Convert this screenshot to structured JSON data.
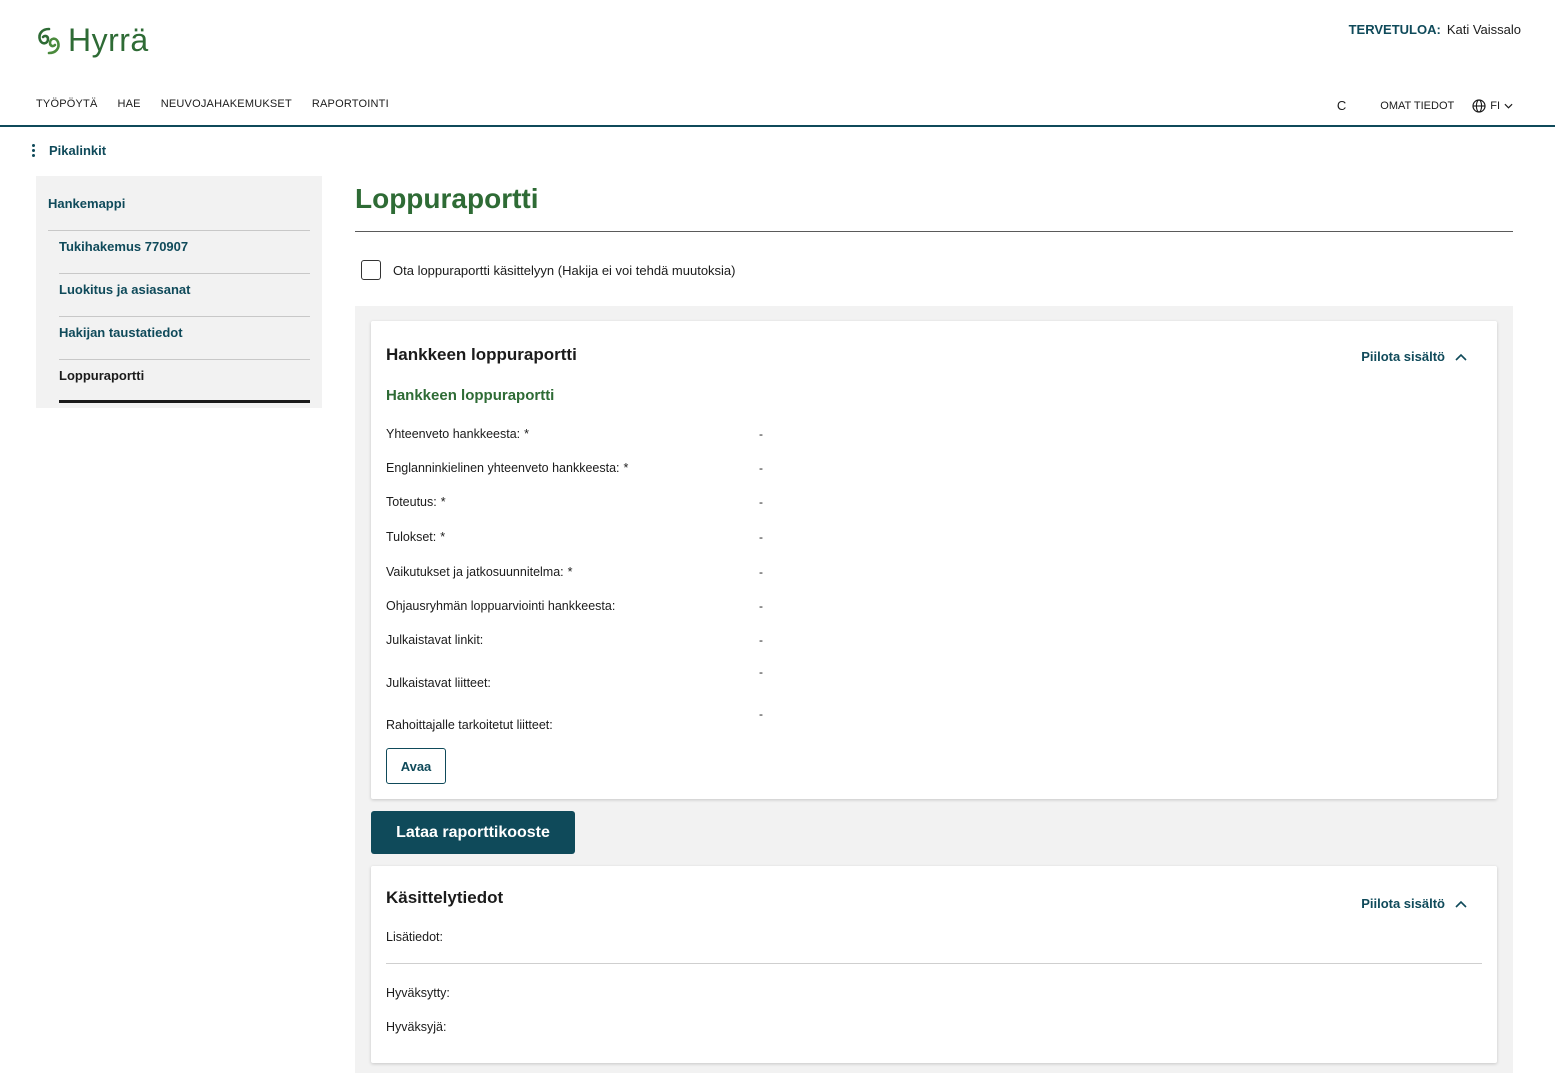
{
  "header": {
    "logo_text": "Hyrrä",
    "welcome_label": "TERVETULOA:",
    "welcome_user": "Kati Vaissalo",
    "nav": [
      "TYÖPÖYTÄ",
      "HAE",
      "NEUVOJAHAKEMUKSET",
      "RAPORTOINTI"
    ],
    "refresh_icon": "C",
    "omat_tiedot": "OMAT TIEDOT",
    "language": "FI"
  },
  "quicklinks": {
    "label": "Pikalinkit"
  },
  "sidebar": {
    "items": [
      {
        "label": "Hankemappi"
      },
      {
        "label": "Tukihakemus 770907"
      },
      {
        "label": "Luokitus ja asiasanat"
      },
      {
        "label": "Hakijan taustatiedot"
      },
      {
        "label": "Loppuraportti"
      }
    ]
  },
  "main": {
    "title": "Loppuraportti",
    "checkbox_label": "Ota loppuraportti käsittelyyn (Hakija ei voi tehdä muutoksia)",
    "report_card": {
      "title": "Hankkeen loppuraportti",
      "toggle": "Piilota sisältö",
      "subtitle": "Hankkeen loppuraportti",
      "fields": [
        {
          "label": "Yhteenveto hankkeesta:",
          "required": "*",
          "value": "-"
        },
        {
          "label": "Englanninkielinen yhteenveto hankkeesta:",
          "required": "*",
          "value": "-"
        },
        {
          "label": "Toteutus:",
          "required": "*",
          "value": "-"
        },
        {
          "label": "Tulokset:",
          "required": "*",
          "value": "-"
        },
        {
          "label": "Vaikutukset ja jatkosuunnitelma:",
          "required": "*",
          "value": "-"
        },
        {
          "label": "Ohjausryhmän loppuarviointi hankkeesta:",
          "required": "",
          "value": "-"
        },
        {
          "label": "Julkaistavat linkit:",
          "required": "",
          "value": "-"
        },
        {
          "label": "Julkaistavat liitteet:",
          "required": "",
          "value": "-"
        },
        {
          "label": "Rahoittajalle tarkoitetut liitteet:",
          "required": "",
          "value": "-"
        }
      ],
      "open_button": "Avaa"
    },
    "download_button": "Lataa raporttikooste",
    "processing_card": {
      "title": "Käsittelytiedot",
      "toggle": "Piilota sisältö",
      "additional_info": "Lisätiedot:",
      "approved": "Hyväksytty:",
      "approver": "Hyväksyjä:"
    }
  },
  "colors": {
    "brand_green": "#2e6b35",
    "primary_blue": "#0f4a5a"
  }
}
